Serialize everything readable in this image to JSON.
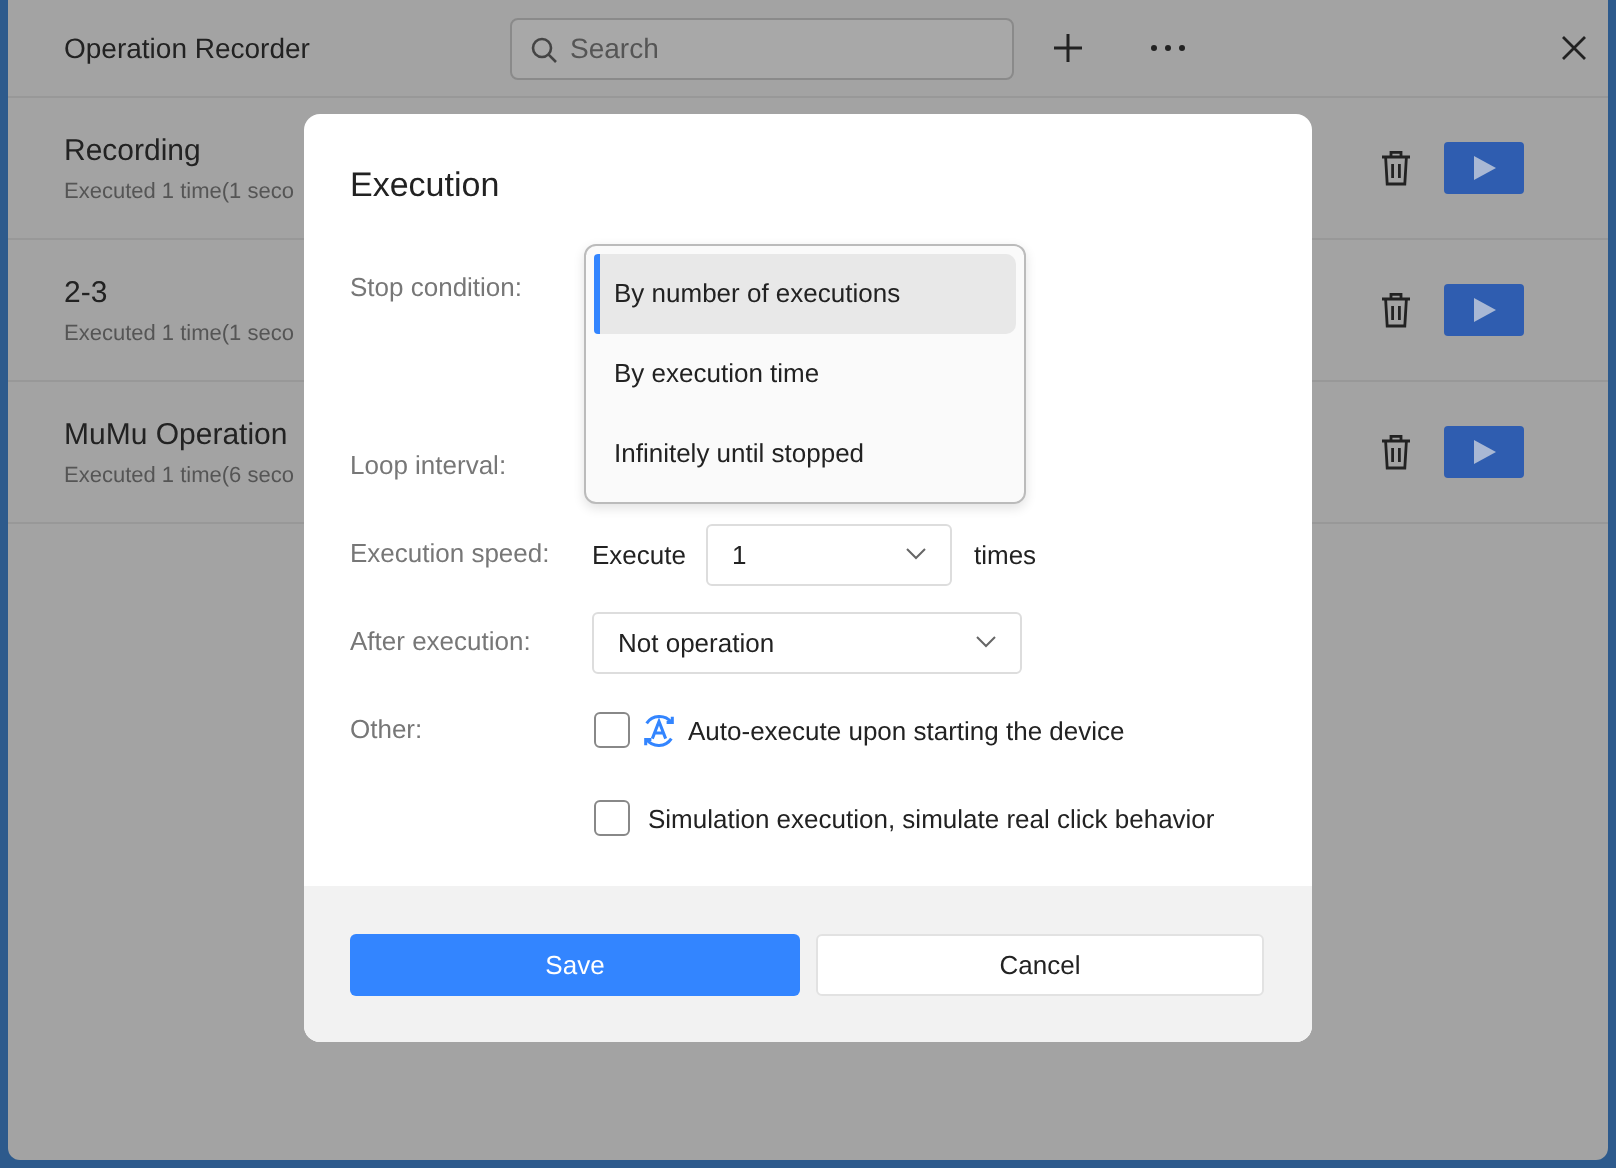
{
  "window": {
    "title": "Operation Recorder"
  },
  "search": {
    "placeholder": "Search"
  },
  "recordings": [
    {
      "name": "Recording",
      "summary": "Executed 1 time(1 seco"
    },
    {
      "name": "2-3",
      "summary": "Executed 1 time(1 seco"
    },
    {
      "name": "MuMu Operation",
      "summary": "Executed 1 time(6 seco"
    }
  ],
  "dialog": {
    "title": "Execution",
    "stop_condition": {
      "label": "Stop condition:",
      "options": [
        {
          "label": "By number of executions",
          "selected": true
        },
        {
          "label": "By execution time",
          "selected": false
        },
        {
          "label": "Infinitely until stopped",
          "selected": false
        }
      ]
    },
    "loop_interval": {
      "label": "Loop interval:"
    },
    "execution_speed": {
      "label": "Execution speed:",
      "prefix": "Execute",
      "value": "1",
      "suffix": "times"
    },
    "after_execution": {
      "label": "After execution:",
      "value": "Not operation"
    },
    "other": {
      "label": "Other:",
      "options": [
        {
          "kind": "with-icon",
          "label": "Auto-execute upon starting the device",
          "checked": false
        },
        {
          "kind": "plain",
          "label": "Simulation execution, simulate real click behavior",
          "checked": false
        }
      ]
    },
    "buttons": [
      {
        "kind": "primary",
        "label": "Save"
      },
      {
        "kind": "secondary",
        "label": "Cancel"
      }
    ]
  }
}
